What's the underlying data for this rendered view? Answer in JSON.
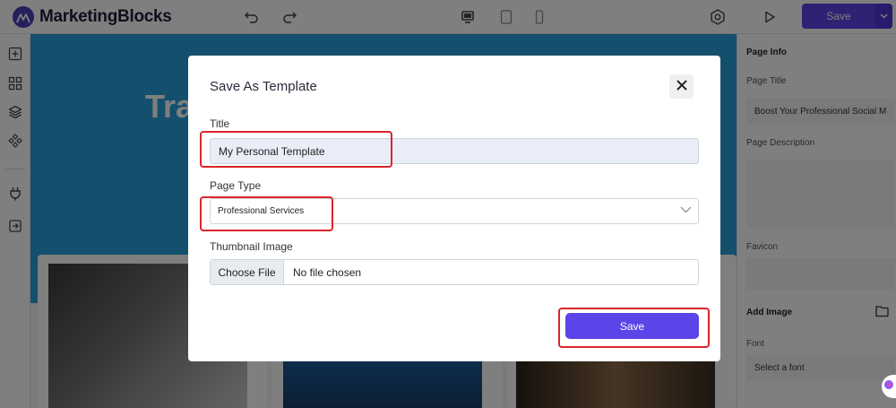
{
  "app": {
    "logo_text": "MarketingBlocks",
    "toolbar_save_label": "Save"
  },
  "canvas": {
    "hero_text": "Tra"
  },
  "right_panel": {
    "section_title": "Page Info",
    "page_title_label": "Page Title",
    "page_title_value": "Boost Your Professional Social M",
    "page_description_label": "Page Description",
    "favicon_label": "Favicon",
    "add_image_label": "Add Image",
    "font_label": "Font",
    "font_placeholder": "Select a font"
  },
  "modal": {
    "title": "Save As Template",
    "title_field_label": "Title",
    "title_field_value": "My Personal Template",
    "page_type_label": "Page Type",
    "page_type_value": "Professional Services",
    "thumbnail_label": "Thumbnail Image",
    "choose_file_label": "Choose File",
    "file_status": "No file chosen",
    "save_label": "Save"
  },
  "colors": {
    "accent": "#5b45e8",
    "highlight": "#d9252b",
    "hero_blue": "#2a9fdc"
  },
  "icons": [
    "logo-icon",
    "undo-icon",
    "redo-icon",
    "desktop-icon",
    "tablet-icon",
    "mobile-icon",
    "settings-icon",
    "preview-icon",
    "chevron-down-icon",
    "add-block-icon",
    "grid-icon",
    "layers-icon",
    "components-icon",
    "plug-icon",
    "exit-icon",
    "close-icon",
    "folder-icon",
    "chat-icon"
  ]
}
